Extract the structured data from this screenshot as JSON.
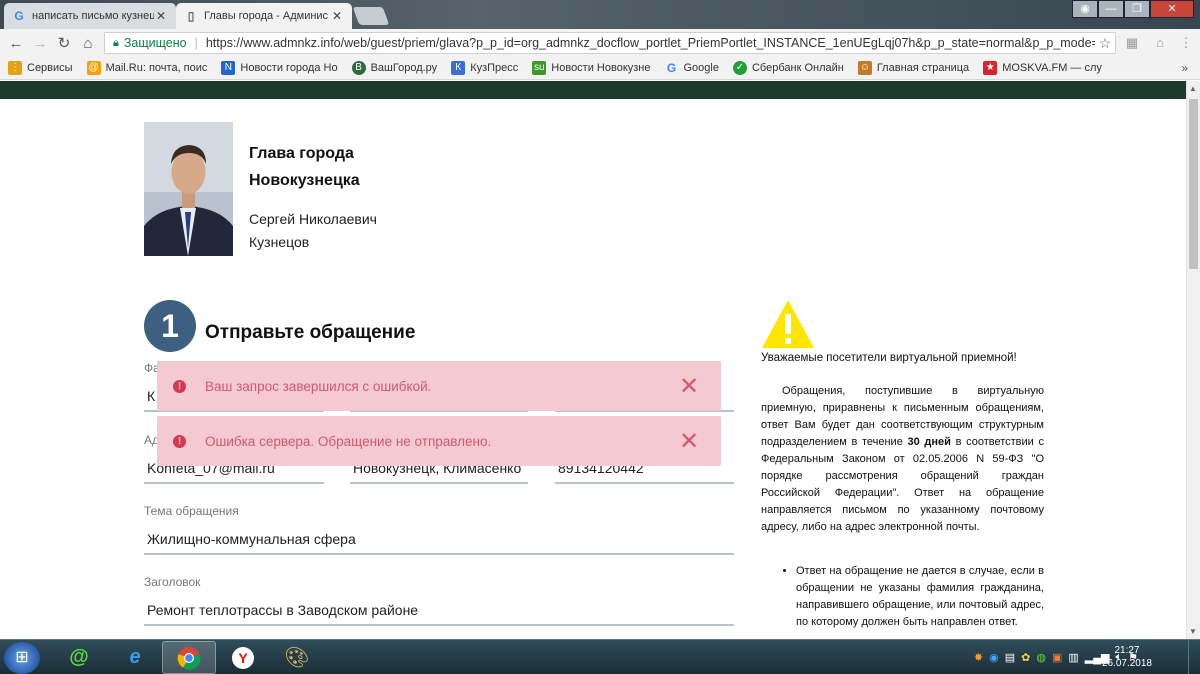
{
  "browser": {
    "tabs": [
      {
        "title": "написать письмо кузнецов",
        "icon": "google-icon",
        "active": false
      },
      {
        "title": "Главы города - Админис",
        "icon": "page-icon",
        "active": true
      }
    ],
    "secure_label": "Защищено",
    "url": "https://www.admnkz.info/web/guest/priem/glava?p_p_id=org_admnkz_docflow_portlet_PriemPortlet_INSTANCE_1enUEgLqj07h&p_p_state=normal&p_p_mode=...",
    "bookmarks": [
      {
        "label": "Сервисы",
        "icon": "apps-icon",
        "color": "#e3a21a"
      },
      {
        "label": "Mail.Ru: почта, поис",
        "icon": "mailru-icon",
        "color": "#f0a30a"
      },
      {
        "label": "Новости города Но",
        "icon": "news-icon",
        "color": "#2266cc"
      },
      {
        "label": "ВашГород.ру",
        "icon": "vg-icon",
        "color": "#2e6d3a"
      },
      {
        "label": "КузПресс",
        "icon": "kuzpress-icon",
        "color": "#3b6fd6"
      },
      {
        "label": "Новости Новокузне",
        "icon": "su-icon",
        "color": "#3a9a2a"
      },
      {
        "label": "Google",
        "icon": "google-icon",
        "color": "#4285f4"
      },
      {
        "label": "Сбербанк Онлайн",
        "icon": "sberbank-icon",
        "color": "#21a038"
      },
      {
        "label": "Главная страница",
        "icon": "person-icon",
        "color": "#c27b2a"
      },
      {
        "label": "MOSKVA.FM — слу",
        "icon": "star-icon",
        "color": "#d6262b"
      }
    ],
    "bookmarks_more": "»"
  },
  "mayor": {
    "title_line1": "Глава города",
    "title_line2": "Новокузнецка",
    "name_line1": "Сергей Николаевич",
    "name_line2": "Кузнецов"
  },
  "form": {
    "step_number": "1",
    "step_title": "Отправьте обращение",
    "label_surname": "Фа",
    "value_surname": "К",
    "label_address": "Ад",
    "value_email": "Konfeta_07@mail.ru",
    "value_city": "Новокузнецк, Климасенко",
    "value_phone": "89134120442",
    "label_topic": "Тема обращения",
    "value_topic": "Жилищно-коммунальная сфера",
    "label_heading": "Заголовок",
    "value_heading": "Ремонт теплотрассы в Заводском районе"
  },
  "toasts": [
    {
      "message": "Ваш запрос завершился с ошибкой.",
      "close": "✕"
    },
    {
      "message": "Ошибка сервера. Обращение не отправлено.",
      "close": "✕"
    }
  ],
  "notice": {
    "heading": "Уважаемые посетители виртуальной приемной!",
    "para_before": "Обращения, поступившие в виртуальную приемную, приравнены к письменным обращениям, ответ Вам будет дан соответствующим структурным подразделением в течение ",
    "para_bold": "30 дней",
    "para_after": " в соответствии с Федеральным Законом от 02.05.2006 N 59-ФЗ \"О порядке рассмотрения обращений граждан Российской Федерации\". Ответ на обращение направляется письмом по указанному почтовому адресу, либо на адрес электронной почты.",
    "bullet_1": "Ответ на обращение не дается в случае, если в обращении не указаны фамилия гражданина, направившего обращение, или почтовый адрес, по которому должен быть направлен ответ."
  },
  "taskbar": {
    "time": "21:27",
    "date": "26.07.2018",
    "apps": [
      "mail-agent-icon",
      "ie-icon",
      "chrome-icon",
      "yandex-icon",
      "paint-icon"
    ]
  },
  "colors": {
    "accent_green": "#1e3a2c",
    "step_blue": "#3d5f80",
    "toast_bg": "#f4c9d1",
    "toast_text": "#d05a6c",
    "warning_yellow": "#ffe600"
  }
}
